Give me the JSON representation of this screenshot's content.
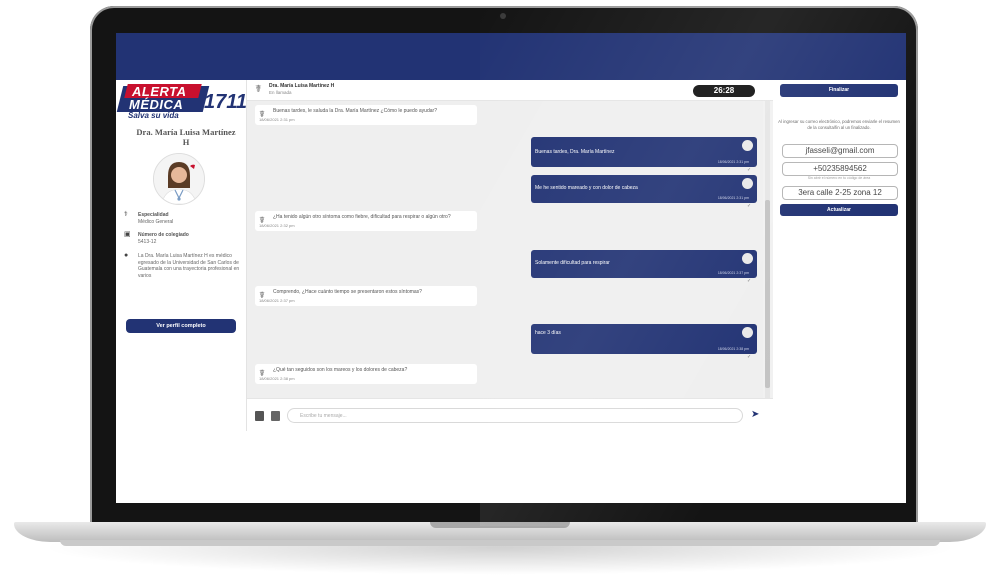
{
  "doctor": {
    "logo_line1": "ALERTA",
    "logo_line2": "MÉDICA",
    "logo_number": "1711",
    "logo_tagline": "Salva su vida",
    "name": "Dra. María Luisa Martínez H",
    "specialty_title": "Especialidad",
    "specialty_value": "Médico General",
    "license_title": "Número de colegiado",
    "license_value": "5413-12",
    "bio": "La Dra. María Luisa Martínez H es médico egresado de la Universidad de San Carlos de Guatemala con una trayectoria profesional en varios",
    "profile_button": "Ver perfil completo"
  },
  "chat": {
    "header_name": "Dra. María Luisa Martínez H",
    "header_status": "En llamada",
    "timer": "26:28",
    "messages": [
      {
        "side": "in",
        "text": "Buenas tardes, le saluda la Dra. María Martínez ¿Cómo le puedo ayudar?",
        "time": "18/06/2021 2:31 pm"
      },
      {
        "side": "out",
        "text": "Buenas tardes, Dra. María Martínez",
        "time": "18/06/2021 2:31 pm"
      },
      {
        "side": "out",
        "text": "Me he sentido mareado y con dolor de cabeza",
        "time": "18/06/2021 2:31 pm"
      },
      {
        "side": "in",
        "text": "¿Ha tenido algún otro síntoma como fiebre, dificultad para respirar o algún otro?",
        "time": "18/06/2021 2:32 pm"
      },
      {
        "side": "out",
        "text": "Solamente dificultad para respirar",
        "time": "18/06/2021 2:37 pm"
      },
      {
        "side": "in",
        "text": "Comprendo, ¿Hace cuánto tiempo se presentaron estos síntomas?",
        "time": "18/06/2021 2:37 pm"
      },
      {
        "side": "out",
        "text": "hace 3 días",
        "time": "18/06/2021 2:38 pm"
      },
      {
        "side": "in",
        "text": "¿Qué tan seguidos son los mareos y los dolores de cabeza?",
        "time": "18/06/2021 2:38 pm"
      }
    ],
    "composer_placeholder": "Escribe tu mensaje..."
  },
  "right": {
    "finish_button": "Finalizar",
    "note": "Al ingresar su correo electrónico, podremos enviarle el resumen de la consulta/fin al un finalizado.",
    "email": "jfasseli@gmail.com",
    "phone": "+50235894562",
    "phone_hint": "Sin abrir el número en tu código de área",
    "address": "3era calle 2-25 zona 12",
    "update_button": "Actualizar"
  },
  "colors": {
    "brand_navy": "#223374",
    "brand_red": "#c8102e"
  }
}
